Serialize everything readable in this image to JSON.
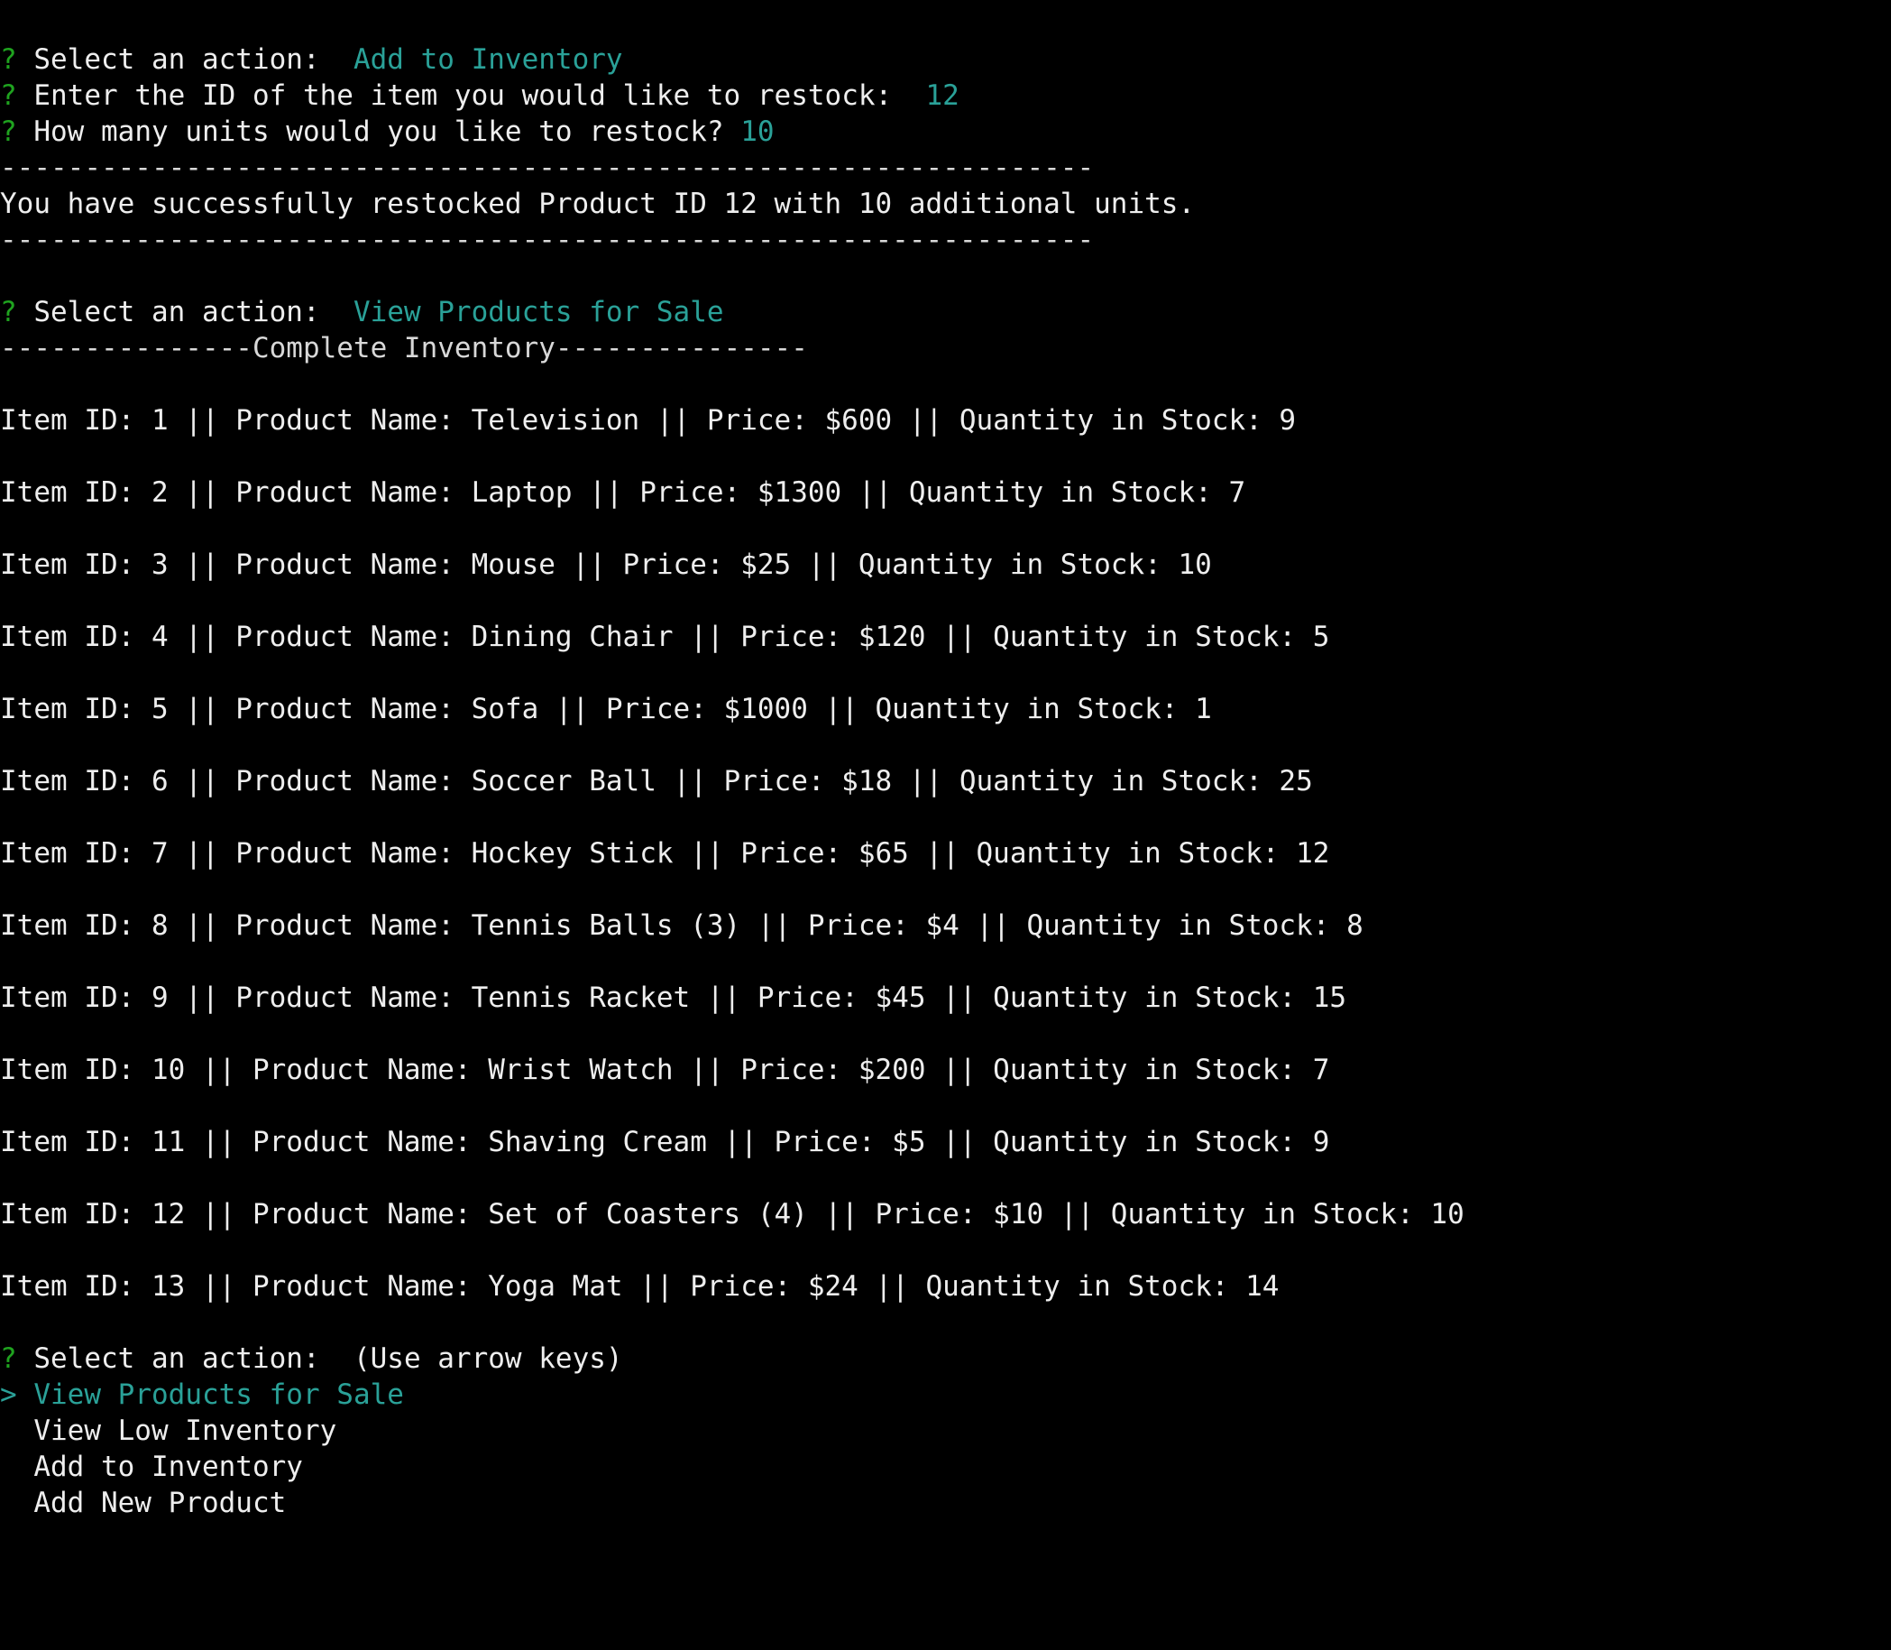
{
  "colors": {
    "background": "#000000",
    "text": "#e6e6e6",
    "prompt_mark": "#1fa31f",
    "answer": "#2aa198"
  },
  "prompt_mark": "?",
  "pointer_mark": ">",
  "session": {
    "restock": {
      "action_label": "Select an action:",
      "action_answer": "Add to Inventory",
      "id_label": "Enter the ID of the item you would like to restock:",
      "id_answer": "12",
      "units_label": "How many units would you like to restock?",
      "units_answer": "10",
      "divider": "-----------------------------------------------------------------",
      "message": "You have successfully restocked Product ID 12 with 10 additional units."
    },
    "view": {
      "action_label": "Select an action:",
      "action_answer": "View Products for Sale",
      "heading": "---------------Complete Inventory---------------"
    },
    "inventory": [
      "Item ID: 1 || Product Name: Television || Price: $600 || Quantity in Stock: 9",
      "Item ID: 2 || Product Name: Laptop || Price: $1300 || Quantity in Stock: 7",
      "Item ID: 3 || Product Name: Mouse || Price: $25 || Quantity in Stock: 10",
      "Item ID: 4 || Product Name: Dining Chair || Price: $120 || Quantity in Stock: 5",
      "Item ID: 5 || Product Name: Sofa || Price: $1000 || Quantity in Stock: 1",
      "Item ID: 6 || Product Name: Soccer Ball || Price: $18 || Quantity in Stock: 25",
      "Item ID: 7 || Product Name: Hockey Stick || Price: $65 || Quantity in Stock: 12",
      "Item ID: 8 || Product Name: Tennis Balls (3) || Price: $4 || Quantity in Stock: 8",
      "Item ID: 9 || Product Name: Tennis Racket || Price: $45 || Quantity in Stock: 15",
      "Item ID: 10 || Product Name: Wrist Watch || Price: $200 || Quantity in Stock: 7",
      "Item ID: 11 || Product Name: Shaving Cream || Price: $5 || Quantity in Stock: 9",
      "Item ID: 12 || Product Name: Set of Coasters (4) || Price: $10 || Quantity in Stock: 10",
      "Item ID: 13 || Product Name: Yoga Mat || Price: $24 || Quantity in Stock: 14"
    ],
    "menu": {
      "action_label": "Select an action:",
      "hint": "(Use arrow keys)",
      "options": [
        "View Products for Sale",
        "View Low Inventory",
        "Add to Inventory",
        "Add New Product"
      ]
    }
  }
}
